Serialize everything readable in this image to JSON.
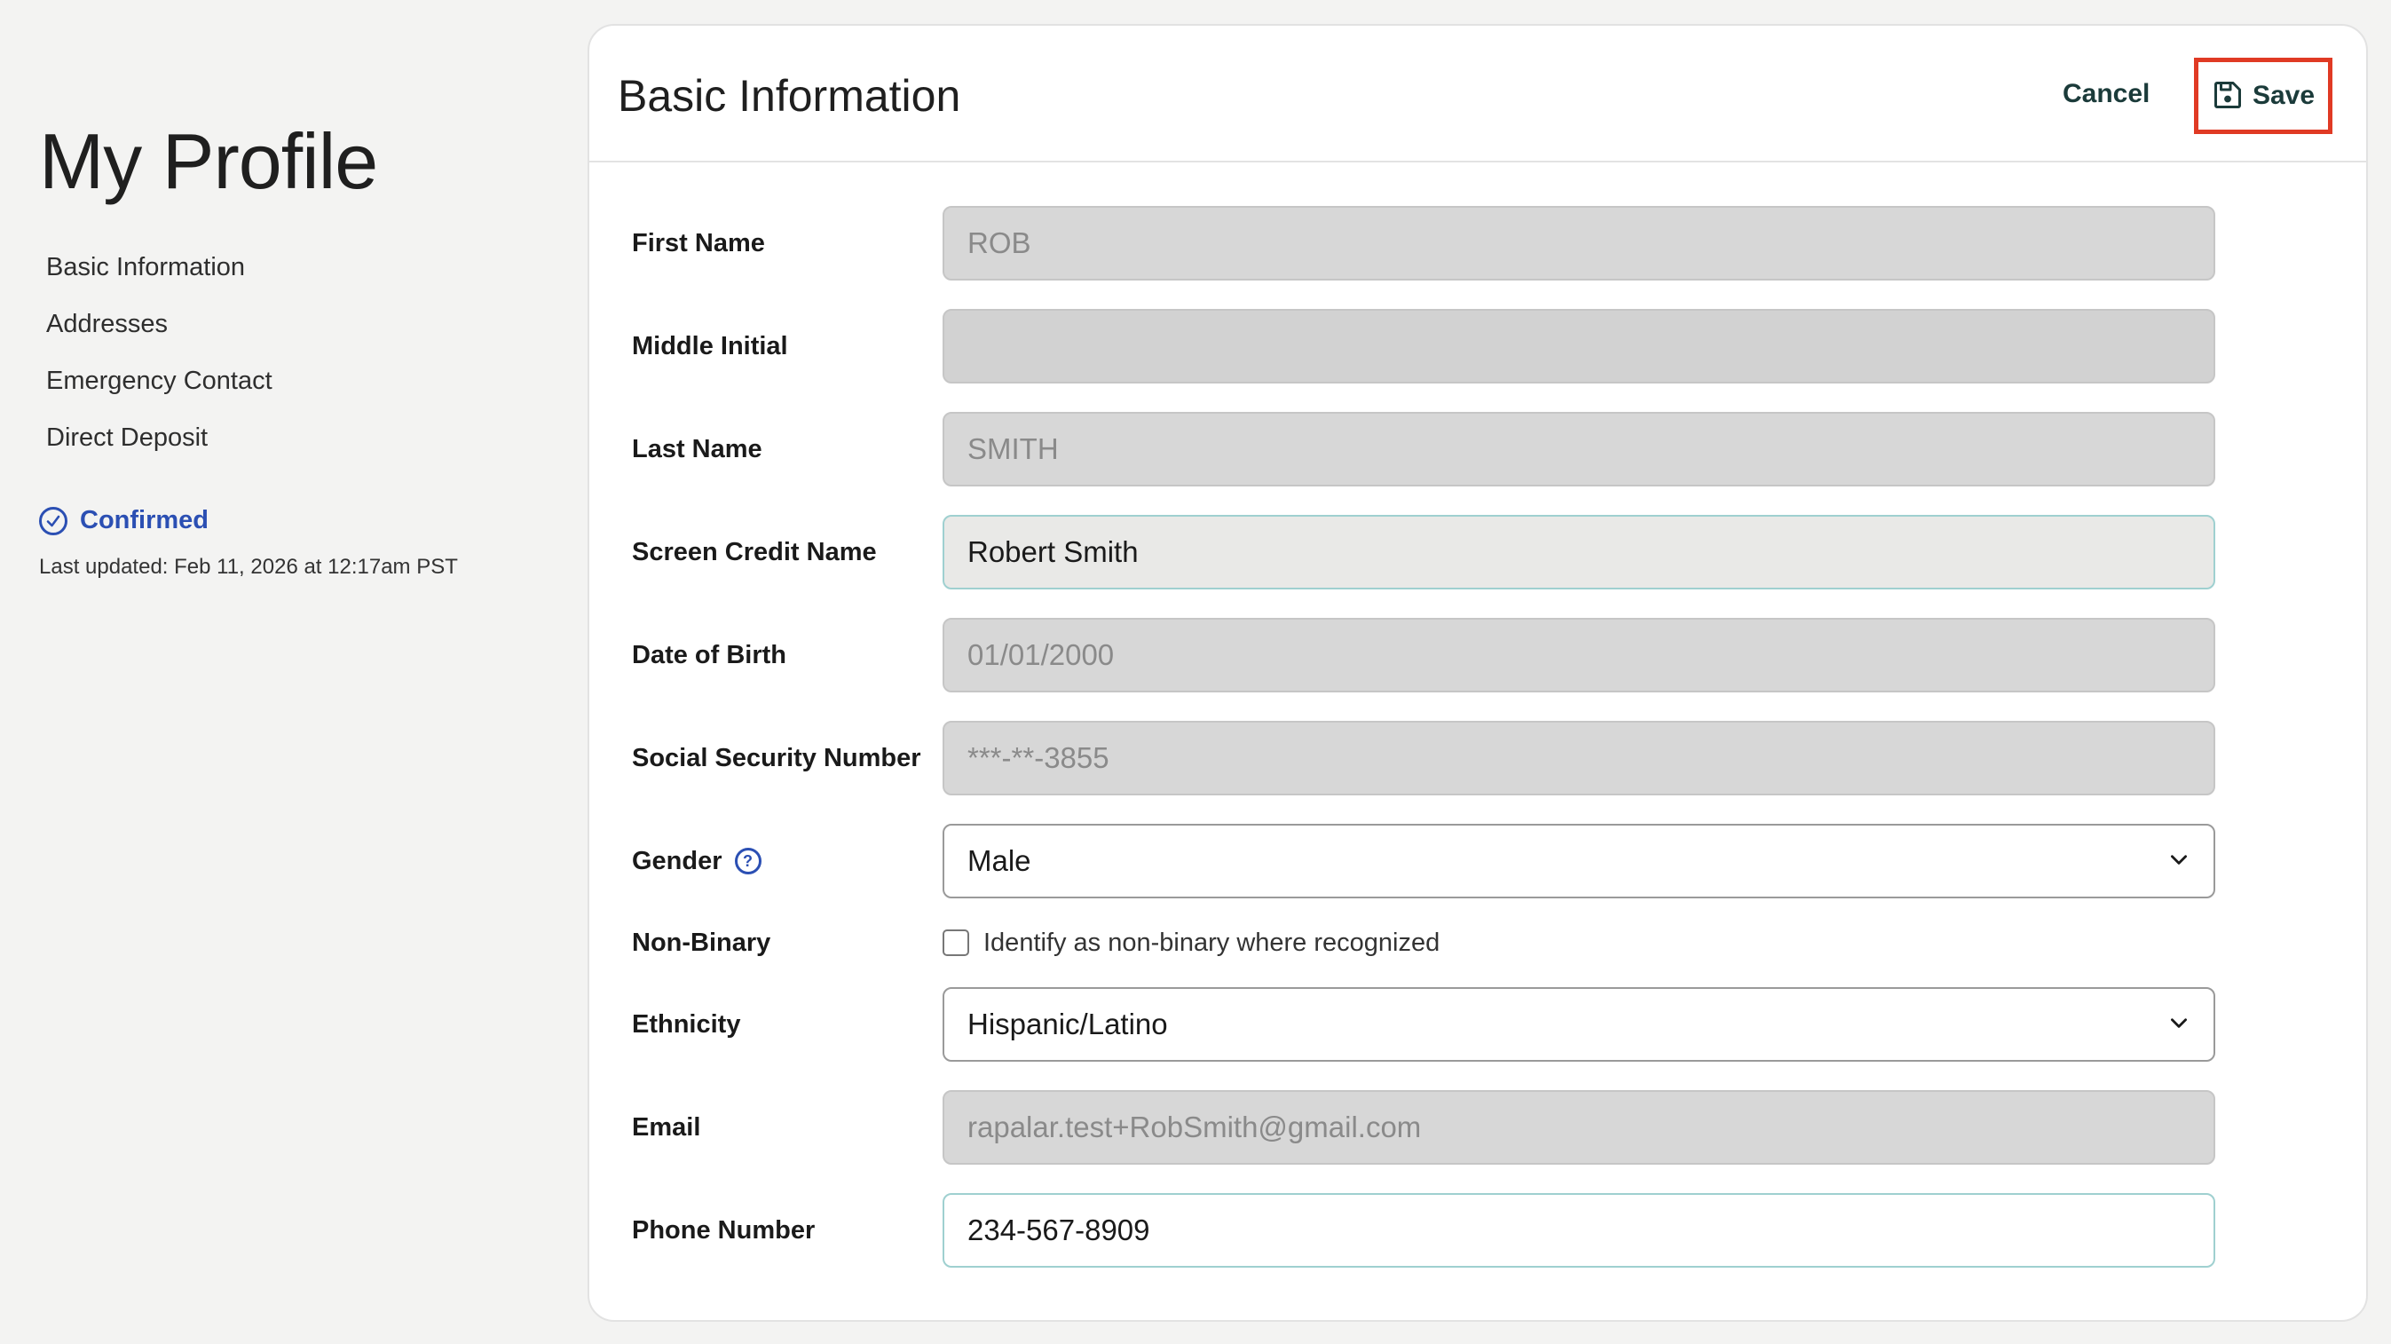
{
  "sidebar": {
    "title": "My Profile",
    "nav": [
      {
        "label": "Basic Information"
      },
      {
        "label": "Addresses"
      },
      {
        "label": "Emergency Contact"
      },
      {
        "label": "Direct Deposit"
      }
    ],
    "status": "Confirmed",
    "last_updated": "Last updated: Feb 11, 2026 at 12:17am PST"
  },
  "card": {
    "title": "Basic Information",
    "cancel_label": "Cancel",
    "save_label": "Save"
  },
  "form": {
    "first_name": {
      "label": "First Name",
      "value": "ROB"
    },
    "middle_initial": {
      "label": "Middle Initial",
      "value": ""
    },
    "last_name": {
      "label": "Last Name",
      "value": "SMITH"
    },
    "screen_credit_name": {
      "label": "Screen Credit Name",
      "value": "Robert Smith"
    },
    "date_of_birth": {
      "label": "Date of Birth",
      "value": "01/01/2000"
    },
    "ssn": {
      "label": "Social Security Number",
      "value": "***-**-3855"
    },
    "gender": {
      "label": "Gender",
      "value": "Male",
      "help_icon": "question-circle-icon"
    },
    "non_binary": {
      "label": "Non-Binary",
      "checkbox_label": "Identify as non-binary where recognized",
      "checked": false
    },
    "ethnicity": {
      "label": "Ethnicity",
      "value": "Hispanic/Latino"
    },
    "email": {
      "label": "Email",
      "value": "rapalar.test+RobSmith@gmail.com"
    },
    "phone": {
      "label": "Phone Number",
      "value": "234-567-8909"
    }
  },
  "colors": {
    "accent_blue": "#2b4fb3",
    "highlight_red": "#e03a24",
    "button_text": "#1b3b3a"
  }
}
